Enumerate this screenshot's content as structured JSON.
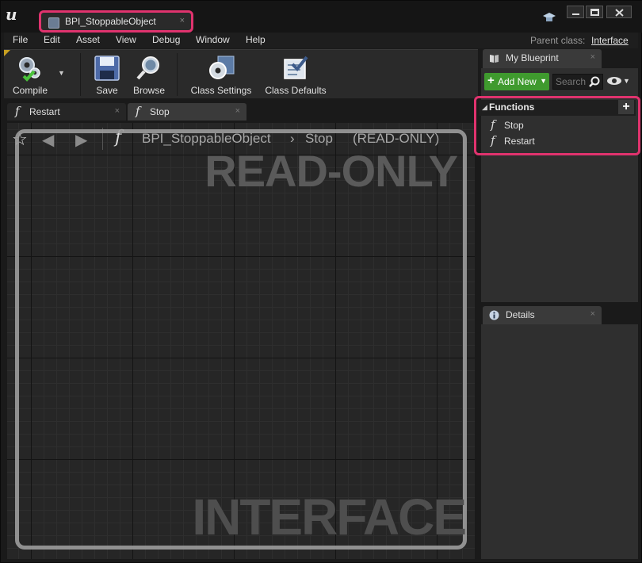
{
  "window": {
    "doc_tab_title": "BPI_StoppableObject",
    "doc_tab_close": "×"
  },
  "menu": {
    "items": [
      "File",
      "Edit",
      "Asset",
      "View",
      "Debug",
      "Window",
      "Help"
    ],
    "parent_class_label": "Parent class:",
    "parent_class_value": "Interface"
  },
  "toolbar": {
    "compile_label": "Compile",
    "save_label": "Save",
    "browse_label": "Browse",
    "class_settings_label": "Class Settings",
    "class_defaults_label": "Class Defaults"
  },
  "graph_tabs": [
    {
      "label": "Restart",
      "close": "×"
    },
    {
      "label": "Stop",
      "close": "×"
    }
  ],
  "graph": {
    "breadcrumb_interface": "BPI_StoppableObject",
    "breadcrumb_sep": "›",
    "breadcrumb_function": "Stop",
    "breadcrumb_status": "(READ-ONLY)",
    "watermark_top": "READ-ONLY",
    "watermark_bottom": "INTERFACE"
  },
  "my_blueprint": {
    "tab_label": "My Blueprint",
    "tab_close": "×",
    "add_new_label": "Add New",
    "search_placeholder": "Search",
    "functions_header": "Functions",
    "functions": [
      "Stop",
      "Restart"
    ]
  },
  "details": {
    "tab_label": "Details",
    "tab_close": "×"
  },
  "colors": {
    "highlight": "#e0336e",
    "add_new_green": "#3f9a2e",
    "panel_bg": "#2f2f2f",
    "graph_bg": "#262626"
  },
  "icons": {
    "engine_logo": "unreal-logo-icon",
    "doc_tab": "blueprint-interface-icon",
    "compile": "compile-gears-icon",
    "save": "floppy-disk-icon",
    "browse": "magnifier-icon",
    "class_settings": "gear-settings-icon",
    "class_defaults": "checklist-icon",
    "function": "function-f-icon",
    "bookmark": "star-icon",
    "back": "arrow-left-icon",
    "forward": "arrow-right-icon",
    "visibility": "eye-icon",
    "details": "info-icon"
  }
}
